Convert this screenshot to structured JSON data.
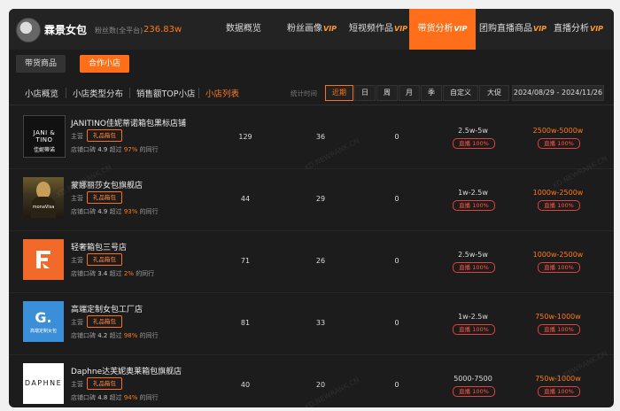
{
  "header": {
    "brand": "霖景女包",
    "fans_label": "粉丝数(全平台)",
    "fans_value": "236.83w",
    "nav": [
      {
        "label": "数据概览",
        "vip": ""
      },
      {
        "label": "粉丝画像",
        "vip": "VIP"
      },
      {
        "label": "短视频作品",
        "vip": "VIP"
      },
      {
        "label": "带货分析",
        "vip": "VIP"
      },
      {
        "label": "团购直播商品",
        "vip": "VIP"
      },
      {
        "label": "直播分析",
        "vip": "VIP"
      }
    ],
    "active_nav": "带货分析"
  },
  "subtabs": {
    "goods": "带货商品",
    "shops": "合作小店"
  },
  "secnav": {
    "items": [
      "小店概览",
      "小店类型分布",
      "销售额TOP小店",
      "小店列表"
    ],
    "active": "小店列表",
    "stat_label": "统计时间",
    "periods": [
      "近期",
      "日",
      "周",
      "月",
      "季",
      "自定义",
      "大促"
    ],
    "active_period": "近期",
    "date_range": "2024/08/29 - 2024/11/26"
  },
  "watermark": "XD.NEWRANK.CN",
  "rows": [
    {
      "name": "JANITINO佳妮蒂诺箱包黑标店铺",
      "main_label": "主营",
      "category": "礼品箱包",
      "rating_label": "店铺口碑",
      "rating": "4.9",
      "beat_label": "超过",
      "beat": "97%",
      "peer_label": "的同行",
      "c1": "129",
      "c2": "36",
      "c3": "0",
      "range1": "2.5w-5w",
      "pill1": "直播 100%",
      "range2": "2500w-5000w",
      "pill2": "直播 100%",
      "logo": {
        "type": "jani",
        "line1": "JANI & TINO",
        "line2": "佳妮蒂诺"
      }
    },
    {
      "name": "蒙娜丽莎女包旗舰店",
      "main_label": "主营",
      "category": "礼品箱包",
      "rating_label": "店铺口碑",
      "rating": "4.9",
      "beat_label": "超过",
      "beat": "93%",
      "peer_label": "的同行",
      "c1": "44",
      "c2": "29",
      "c3": "0",
      "range1": "1w-2.5w",
      "pill1": "直播 100%",
      "range2": "1000w-2500w",
      "pill2": "直播 100%",
      "logo": {
        "type": "mona",
        "line1": "monaVisa"
      }
    },
    {
      "name": "轻奢箱包三号店",
      "main_label": "主营",
      "category": "礼品箱包",
      "rating_label": "店铺口碑",
      "rating": "3.4",
      "beat_label": "超过",
      "beat": "2%",
      "peer_label": "的同行",
      "c1": "71",
      "c2": "26",
      "c3": "0",
      "range1": "2.5w-5w",
      "pill1": "直播 100%",
      "range2": "1000w-2500w",
      "pill2": "直播 100%",
      "logo": {
        "type": "orange",
        "line1": ""
      }
    },
    {
      "name": "高端定制女包工厂店",
      "main_label": "主营",
      "category": "礼品箱包",
      "rating_label": "店铺口碑",
      "rating": "4.2",
      "beat_label": "超过",
      "beat": "98%",
      "peer_label": "的同行",
      "c1": "81",
      "c2": "33",
      "c3": "0",
      "range1": "1w-2.5w",
      "pill1": "直播 100%",
      "range2": "750w-1000w",
      "pill2": "直播 100%",
      "logo": {
        "type": "blue",
        "line1": "G.",
        "line2": "高端定制女包"
      }
    },
    {
      "name": "Daphne达芙妮奥莱箱包旗舰店",
      "main_label": "主营",
      "category": "礼品箱包",
      "rating_label": "店铺口碑",
      "rating": "4.8",
      "beat_label": "超过",
      "beat": "94%",
      "peer_label": "的同行",
      "c1": "40",
      "c2": "20",
      "c3": "0",
      "range1": "5000-7500",
      "pill1": "直播 100%",
      "range2": "750w-1000w",
      "pill2": "直播 100%",
      "logo": {
        "type": "daphne",
        "line1": "DAPHNE"
      }
    }
  ],
  "colors": {
    "accent": "#ff6f1a",
    "pill": "#e0443a",
    "bg": "#1c1c1c"
  }
}
